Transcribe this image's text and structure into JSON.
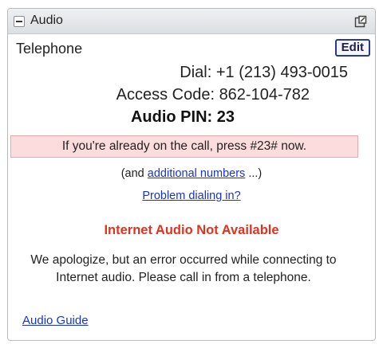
{
  "panel": {
    "title": "Audio",
    "collapse_icon": "minus-icon",
    "popout_icon": "popout-window-icon"
  },
  "telephone": {
    "title": "Telephone",
    "edit_label": "Edit",
    "dial_label": "Dial:",
    "dial_number": "+1 (213) 493-0015",
    "access_label": "Access Code:",
    "access_code": "862-104-782",
    "pin_label": "Audio PIN:",
    "pin_value": "23",
    "notice": "If you're already on the call, press #23# now.",
    "additional_prefix": "(and ",
    "additional_link": "additional numbers",
    "additional_suffix": " ...)",
    "problem_link": "Problem dialing in?"
  },
  "internet_audio": {
    "error_title": "Internet Audio Not Available",
    "error_message": "We apologize, but an error occurred while connecting to Internet audio. Please call in from a telephone.",
    "error_color": "#e3311d"
  },
  "footer": {
    "audio_guide_link": "Audio Guide"
  }
}
